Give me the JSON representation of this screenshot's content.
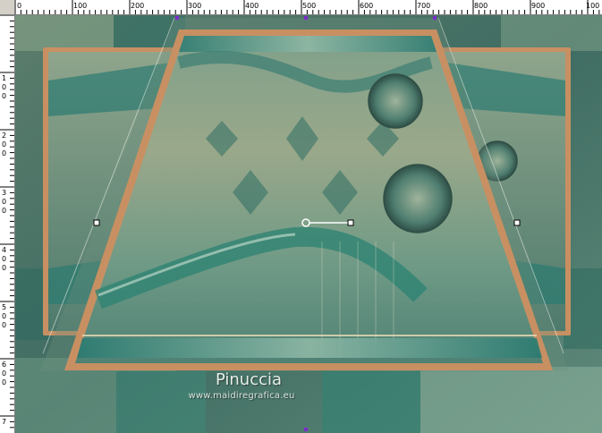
{
  "ruler": {
    "top_labels": [
      "0",
      "100",
      "200",
      "300",
      "400",
      "500",
      "600",
      "700",
      "800",
      "900",
      "100"
    ],
    "left_labels": [
      "1",
      "0",
      "0",
      "2",
      "0",
      "0",
      "3",
      "0",
      "0",
      "4",
      "0",
      "0",
      "5",
      "0",
      "0",
      "6",
      "0",
      "0",
      "7"
    ]
  },
  "watermark": {
    "title": "Pinuccia",
    "url": "www.maidiregrafica.eu"
  },
  "colors": {
    "teal": "#2f7c74",
    "frame": "#c89062",
    "handle": "#7b2ccb"
  }
}
